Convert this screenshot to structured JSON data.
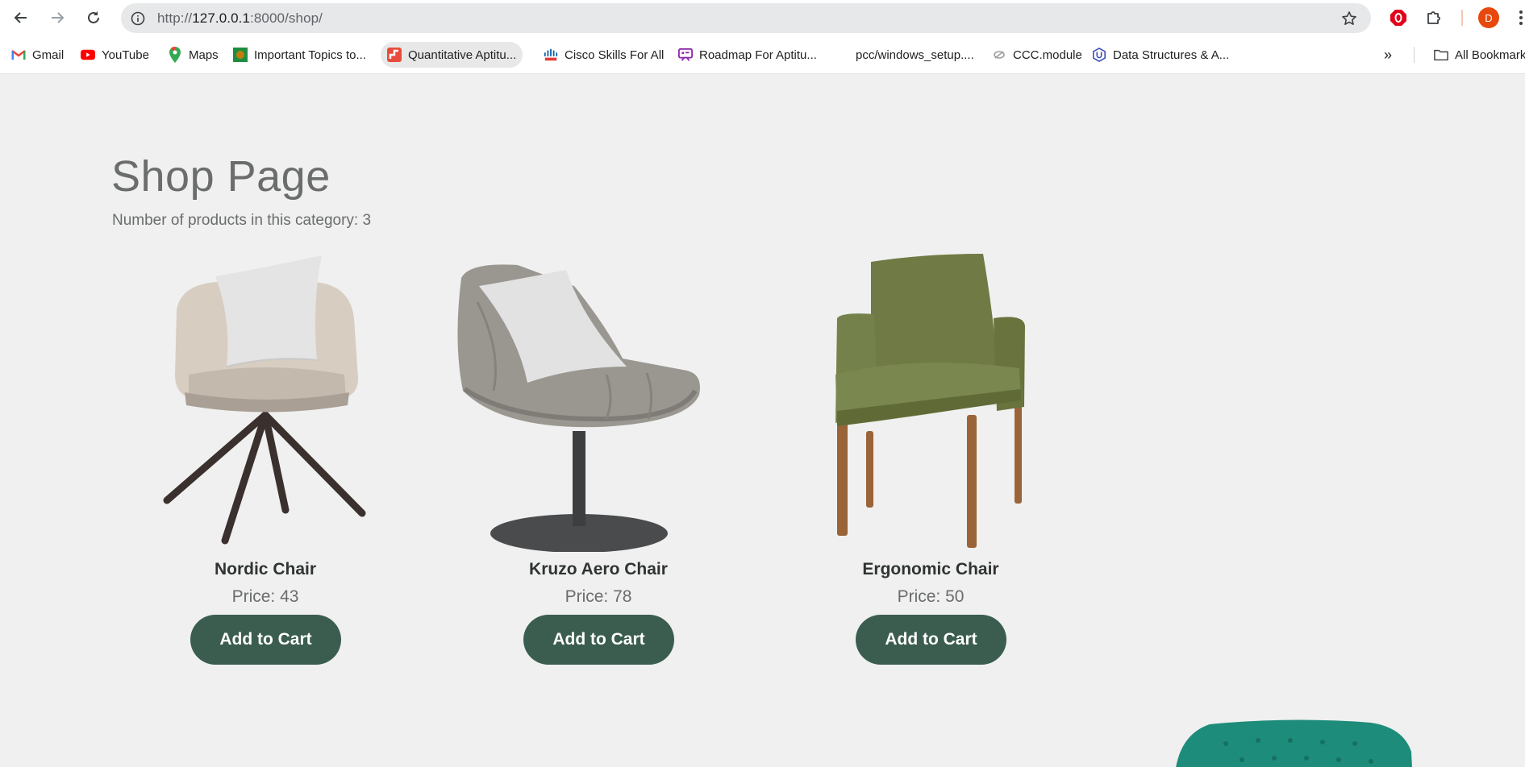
{
  "browser": {
    "url_scheme": "http://",
    "url_host": "127.0.0.1",
    "url_rest": ":8000/shop/",
    "profile_initial": "D"
  },
  "bookmarks": {
    "items": [
      {
        "label": "Gmail",
        "icon": "gmail-icon"
      },
      {
        "label": "YouTube",
        "icon": "youtube-icon"
      },
      {
        "label": "Maps",
        "icon": "maps-icon"
      },
      {
        "label": "Important Topics to...",
        "icon": "bookmark-favicon"
      },
      {
        "label": "Quantitative Aptitu...",
        "icon": "bookmark-favicon"
      },
      {
        "label": "Cisco Skills For All",
        "icon": "cisco-icon"
      },
      {
        "label": "Roadmap For Aptitu...",
        "icon": "bookmark-favicon"
      },
      {
        "label": "pcc/windows_setup....",
        "icon": "bookmark-favicon"
      },
      {
        "label": "CCC.module",
        "icon": "bookmark-favicon"
      },
      {
        "label": "Data Structures & A...",
        "icon": "udacity-icon"
      }
    ],
    "more": "»",
    "all_bookmarks": "All Bookmarks"
  },
  "page": {
    "title": "Shop Page",
    "count_text": "Number of products in this category: 3",
    "products": [
      {
        "name": "Nordic Chair",
        "price": "Price: 43",
        "button": "Add to Cart"
      },
      {
        "name": "Kruzo Aero Chair",
        "price": "Price: 78",
        "button": "Add to Cart"
      },
      {
        "name": "Ergonomic Chair",
        "price": "Price: 50",
        "button": "Add to Cart"
      }
    ]
  },
  "colors": {
    "accent": "#3b5d50",
    "page_bg": "#eff0ef",
    "text_muted": "#6a6d6c"
  }
}
